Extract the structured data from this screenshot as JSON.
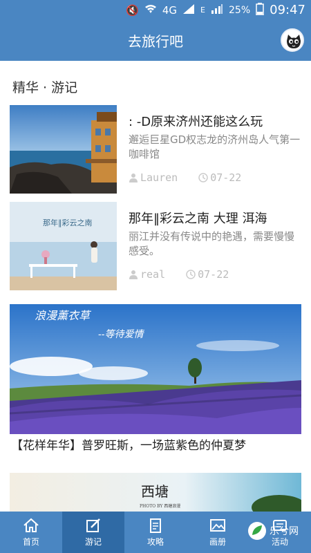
{
  "status": {
    "network": "4G",
    "signal": "E",
    "battery": "25%",
    "time": "09:47"
  },
  "header": {
    "title": "去旅行吧"
  },
  "section": {
    "title": "精华 · 游记"
  },
  "articles": [
    {
      "title": ": -D原来济州还能这么玩",
      "desc": "邂逅巨星GD权志龙的济州岛人气第一咖啡馆",
      "author": "Lauren",
      "date": "07-22"
    },
    {
      "title": "那年‖彩云之南 大理 洱海",
      "desc": "丽江并没有传说中的艳遇，需要慢慢感受。",
      "author": "real",
      "date": "07-22"
    }
  ],
  "banners": [
    {
      "title_art": "浪漫薰衣草",
      "subtitle_art": "--等待爱情",
      "caption": "【花样年华】普罗旺斯，一场蓝紫色的仲夏梦"
    },
    {
      "title_art": "西塘",
      "subtitle_art": "PHOTO BY 西塘浪漫"
    }
  ],
  "thumb2_art": "那年‖彩云之南",
  "tabs": [
    {
      "label": "首页",
      "icon": "home-icon"
    },
    {
      "label": "游记",
      "icon": "edit-icon"
    },
    {
      "label": "攻略",
      "icon": "guide-icon"
    },
    {
      "label": "画册",
      "icon": "album-icon"
    },
    {
      "label": "活动",
      "icon": "activity-icon"
    }
  ],
  "watermark": "乐兮网",
  "colors": {
    "primary": "#4a86c2",
    "active_tab": "#2f6aa5",
    "meta": "#bbbbbb"
  }
}
